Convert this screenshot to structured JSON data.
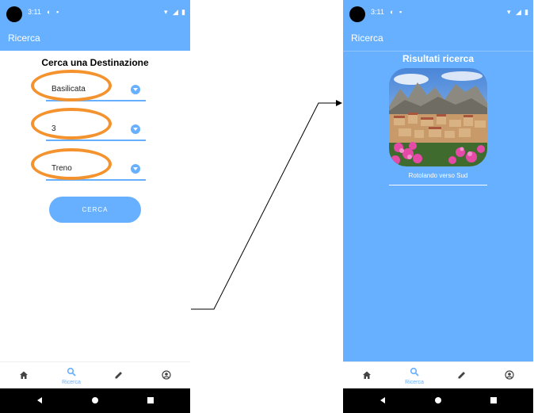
{
  "status": {
    "time": "3:11"
  },
  "left": {
    "appbar_title": "Ricerca",
    "heading": "Cerca una Destinazione",
    "fields": [
      {
        "value": "Basilicata"
      },
      {
        "value": "3"
      },
      {
        "value": "Treno"
      }
    ],
    "search_button": "CERCA"
  },
  "right": {
    "appbar_title": "Ricerca",
    "heading": "Risultati ricerca",
    "result_caption": "Rotolando verso Sud"
  },
  "bottom_nav": {
    "active_label": "Ricerca",
    "items": [
      "home-icon",
      "search-icon",
      "edit-icon",
      "account-icon"
    ]
  },
  "colors": {
    "primary": "#66b0ff",
    "highlight": "#f4932e"
  }
}
